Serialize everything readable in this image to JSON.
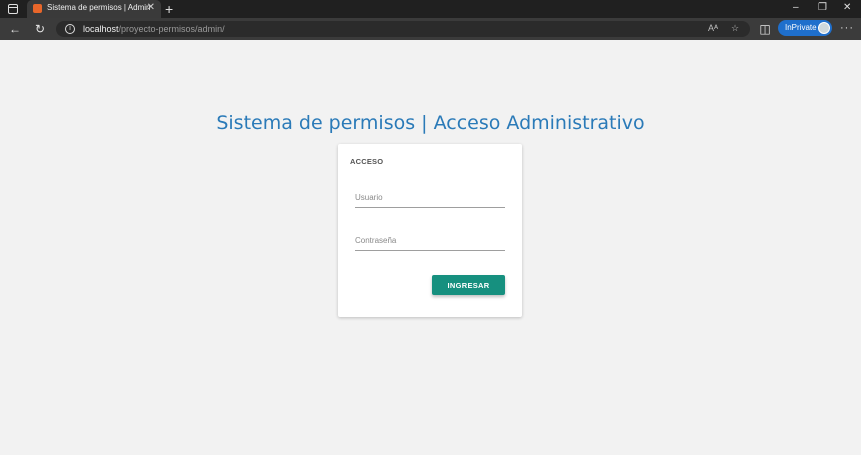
{
  "browser": {
    "tab_title": "Sistema de permisos | Admin",
    "tab_close": "✕",
    "new_tab": "+",
    "window_controls": {
      "minimize": "–",
      "restore": "❐",
      "close": "✕"
    },
    "address_host": "localhost",
    "address_path": "/proyecto-permisos/admin/",
    "inprivate_label": "InPrivate",
    "read_aloud_glyph": "Aᴬ",
    "favorite_glyph": "☆",
    "split_glyph": "◫",
    "more_glyph": "···"
  },
  "page": {
    "title": "Sistema de permisos | Acceso Administrativo"
  },
  "login": {
    "heading": "ACCESO",
    "username_placeholder": "Usuario",
    "password_placeholder": "Contraseña",
    "submit_label": "INGRESAR"
  },
  "colors": {
    "title": "#2a7ab8",
    "button": "#16907f",
    "background": "#f2f2f2"
  }
}
